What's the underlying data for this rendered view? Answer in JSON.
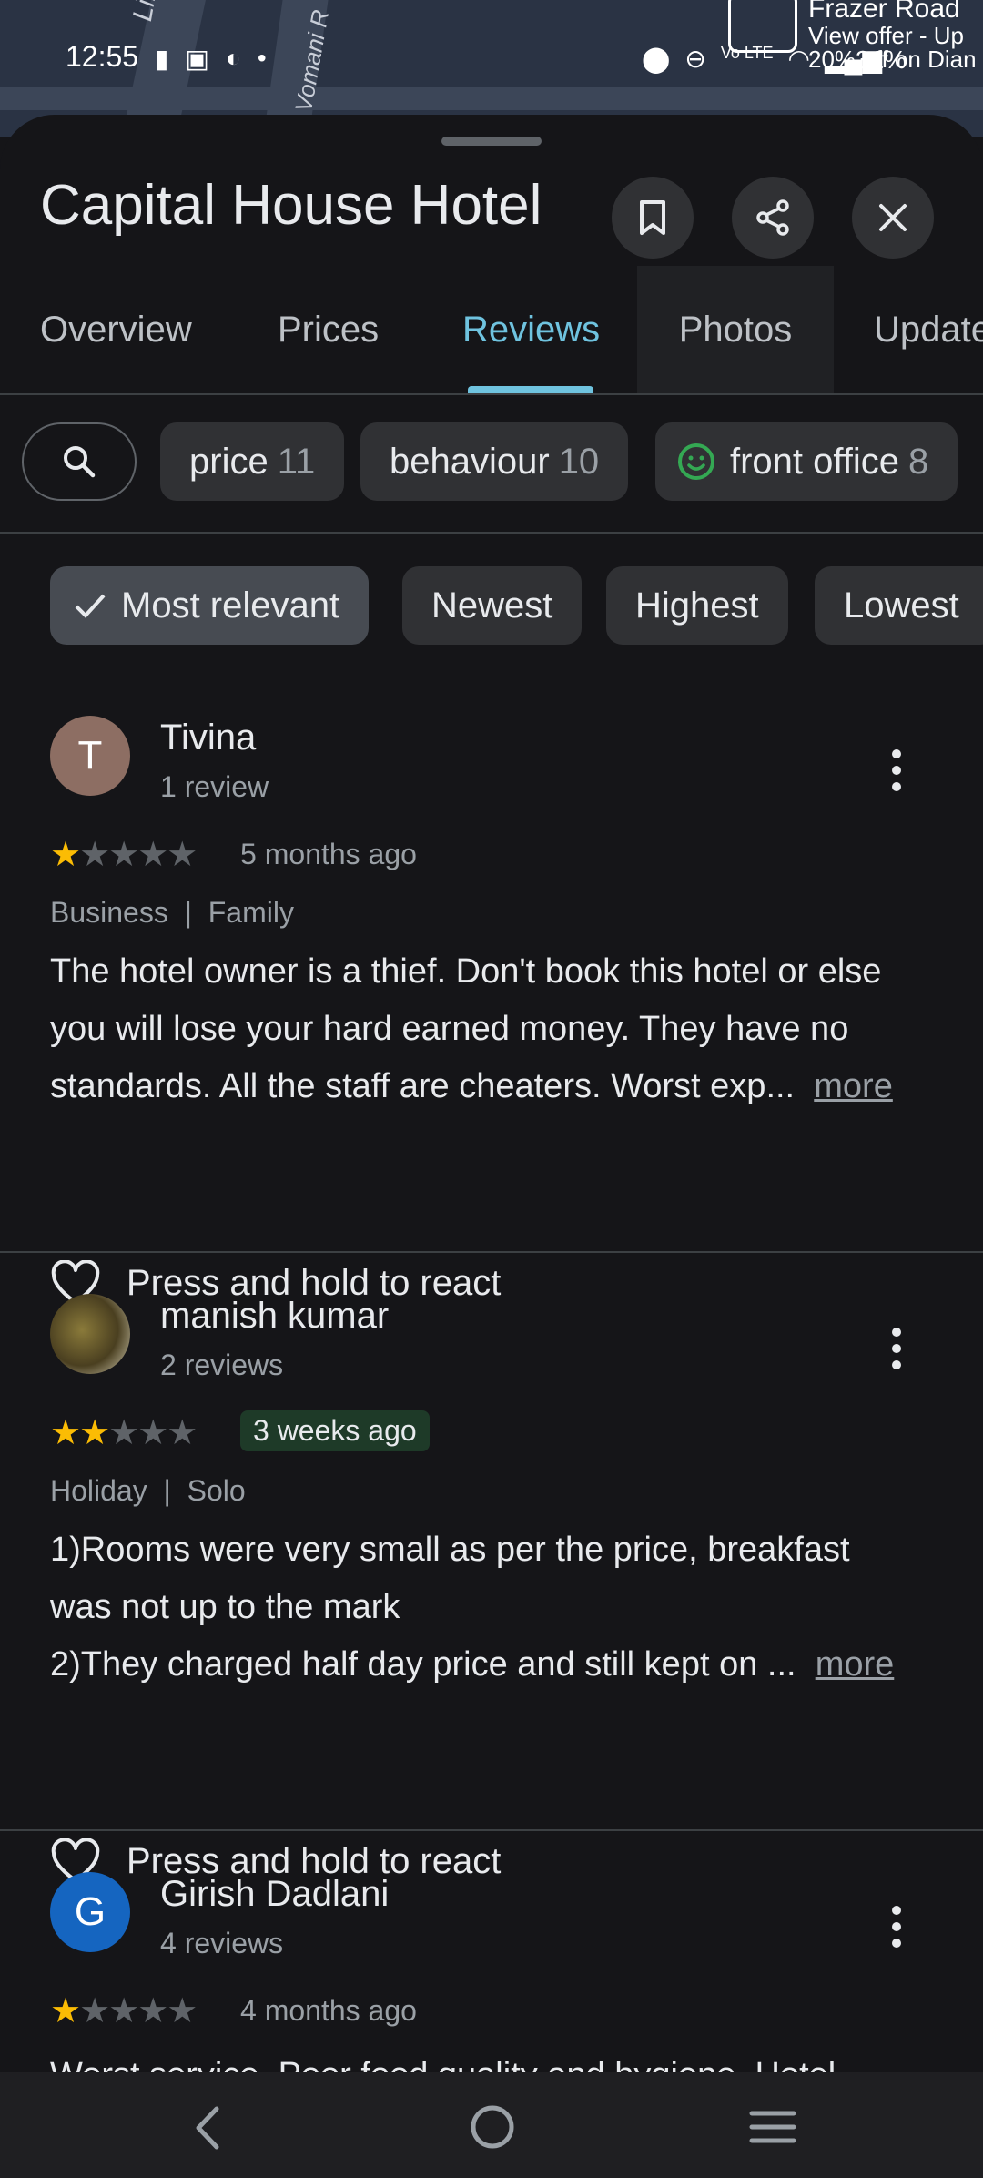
{
  "map": {
    "labels": [
      "Library",
      "Vomani R"
    ],
    "poi_title": "Frazer Road",
    "poi_offer_line1": "View offer - Up",
    "poi_offer_line2": "20% off on Dian"
  },
  "status_bar": {
    "time": "12:55",
    "battery": "31%"
  },
  "place": {
    "title": "Capital House Hotel"
  },
  "tabs": [
    {
      "label": "Overview"
    },
    {
      "label": "Prices"
    },
    {
      "label": "Reviews"
    },
    {
      "label": "Photos"
    },
    {
      "label": "Update"
    }
  ],
  "topic_chips": [
    {
      "label": "price",
      "count": "11"
    },
    {
      "label": "behaviour",
      "count": "10"
    },
    {
      "label": "front office",
      "count": "8"
    }
  ],
  "sort_chips": [
    {
      "label": "Most relevant"
    },
    {
      "label": "Newest"
    },
    {
      "label": "Highest"
    },
    {
      "label": "Lowest"
    }
  ],
  "reviews": [
    {
      "initial": "T",
      "name": "Tivina",
      "count": "1 review",
      "rating": 1,
      "ago": "5 months ago",
      "tags": "Business  |  Family",
      "line1": "The hotel owner is a thief. Don't book this hotel or else",
      "line2": "you will lose your hard earned money. They have no",
      "line3": "standards. All the staff are cheaters. Worst exp...",
      "more": "more",
      "react": "Press and hold to react"
    },
    {
      "initial": "",
      "name": "manish kumar",
      "count": "2 reviews",
      "rating": 2,
      "ago": "3 weeks ago",
      "tags": "Holiday  |  Solo",
      "line1": "1)Rooms were very small as per the price, breakfast",
      "line2": "was not up to the mark",
      "line3": "2)They charged half day price and still kept on ...",
      "more": "more",
      "react": "Press and hold to react"
    },
    {
      "initial": "G",
      "name": "Girish Dadlani",
      "count": "4 reviews",
      "rating": 1,
      "ago": "4 months ago",
      "line1": "Worst service. Poor food quality and hygiene. Hotel"
    }
  ],
  "colors": {
    "accent": "#6fc3df",
    "star": "#fbbc04",
    "avatar_t": "#8d6e63",
    "avatar_g": "#1565c0"
  }
}
